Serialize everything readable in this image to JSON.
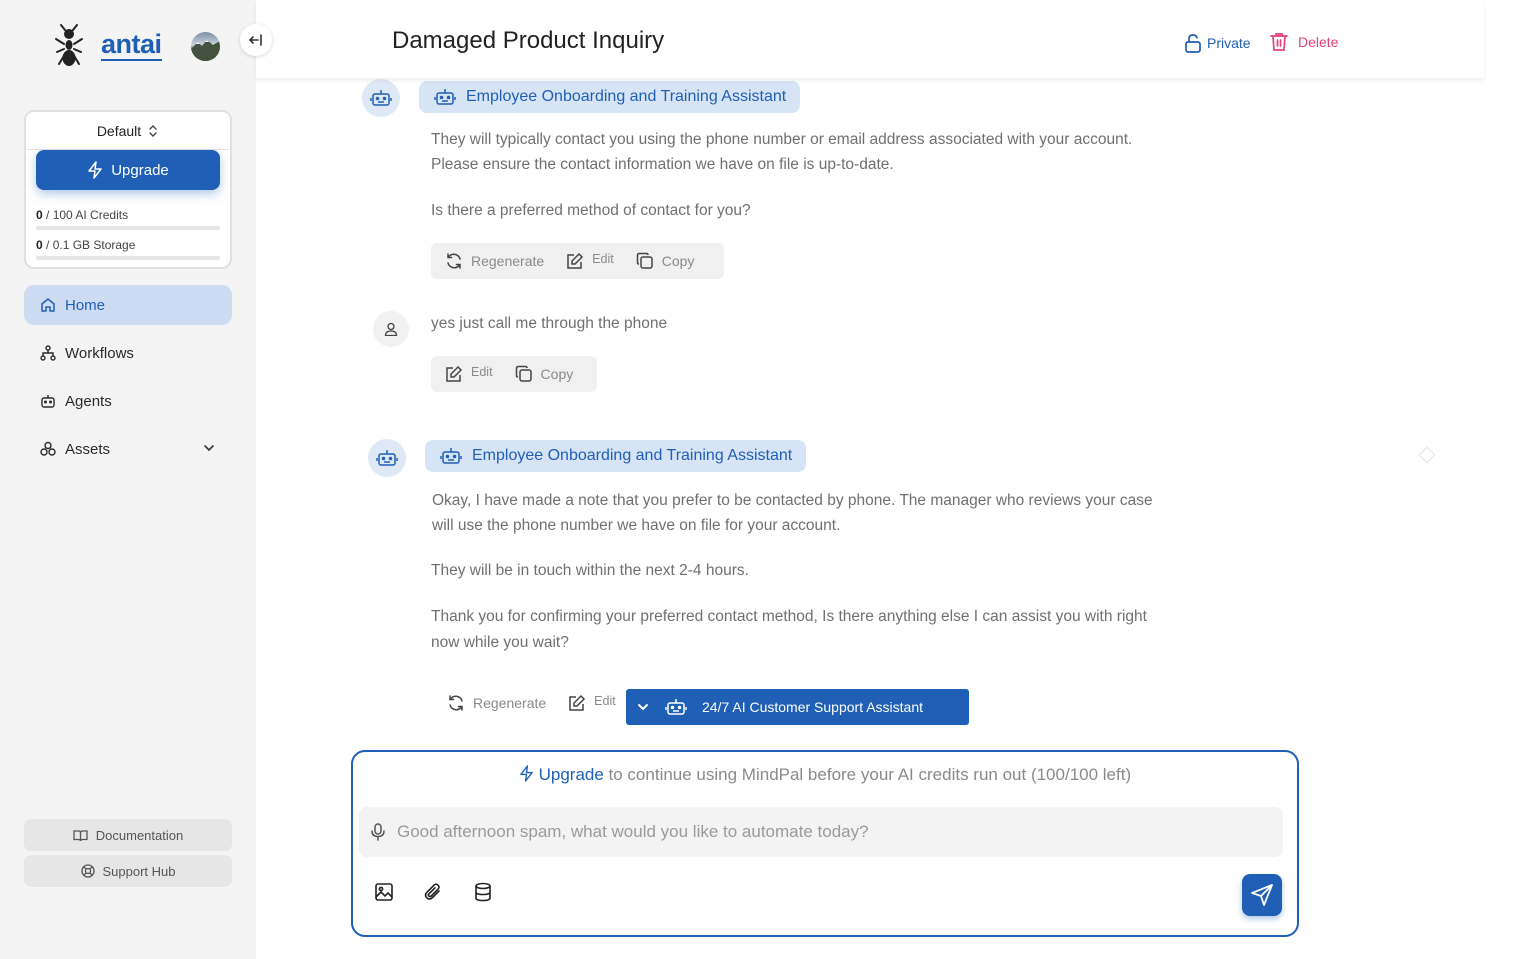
{
  "brand": {
    "name": "antai"
  },
  "sidebar": {
    "workspace": "Default",
    "upgrade_label": "Upgrade",
    "credits": {
      "used": "0",
      "total_text": " / 100 AI Credits",
      "fraction": 0
    },
    "storage": {
      "used": "0",
      "total_text": " / 0.1 GB Storage",
      "fraction": 0
    },
    "nav": [
      {
        "label": "Home",
        "icon": "home-icon",
        "active": true
      },
      {
        "label": "Workflows",
        "icon": "workflow-icon"
      },
      {
        "label": "Agents",
        "icon": "robot-icon"
      },
      {
        "label": "Assets",
        "icon": "assets-icon"
      }
    ],
    "documentation": "Documentation",
    "support": "Support Hub"
  },
  "header": {
    "title": "Damaged Product Inquiry",
    "private_label": "Private",
    "delete_label": "Delete"
  },
  "chat": {
    "messages": [
      {
        "role": "assistant",
        "agent": "Employee Onboarding and Training Assistant",
        "paragraphs": [
          "They will typically contact you using the phone number or email address associated with your account. Please ensure the contact information we have on file is up-to-date.",
          "Is there a preferred method of contact for you?"
        ],
        "actions": {
          "regenerate": "Regenerate",
          "edit": "Edit",
          "copy": "Copy"
        }
      },
      {
        "role": "user",
        "text": "yes just call me through the phone",
        "actions": {
          "edit": "Edit",
          "copy": "Copy"
        }
      },
      {
        "role": "assistant",
        "agent": "Employee Onboarding and Training Assistant",
        "paragraphs": [
          "Okay, I have made a note that you prefer to be contacted by phone. The manager who reviews your case will use the phone number we have on file for your account.",
          "They will be in touch within the next 2-4 hours.",
          "Thank you for confirming your preferred contact method, Is there anything else I can assist you with right now while you wait?"
        ],
        "actions": {
          "regenerate": "Regenerate",
          "edit": "Edit"
        }
      }
    ],
    "agent_selector": "24/7 AI Customer Support Assistant"
  },
  "composer": {
    "upgrade_link": "Upgrade",
    "upgrade_text": " to continue using MindPal before your AI credits run out (100/100 left)",
    "placeholder": "Good afternoon spam, what would you like to automate today?"
  },
  "colors": {
    "accent": "#1f5fb5",
    "danger": "#e3417a",
    "sidebar_bg": "#f4f4f4"
  }
}
